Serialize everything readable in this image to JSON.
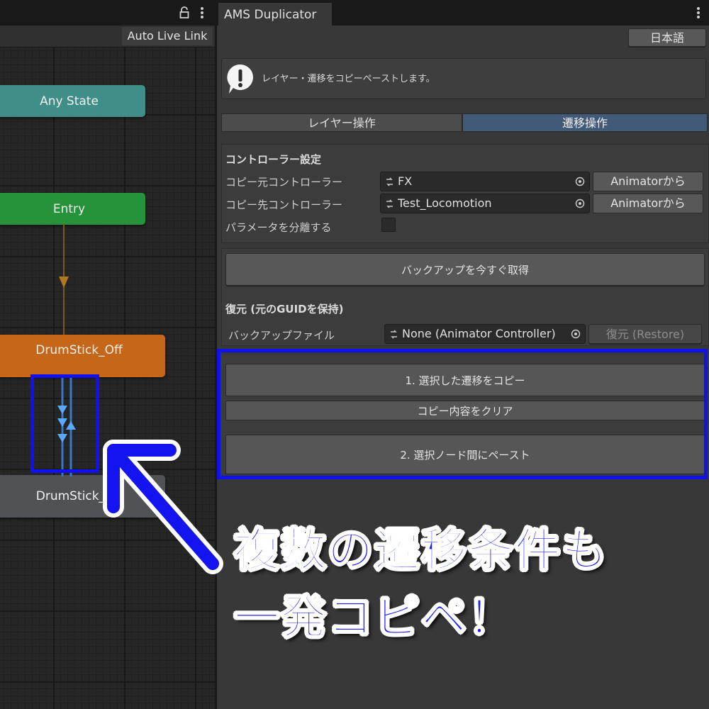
{
  "animator": {
    "auto_live_link_label": "Auto Live Link",
    "states": {
      "any_state": "Any State",
      "entry": "Entry",
      "drumstick_off": "DrumStick_Off",
      "drumstick_on": "DrumStick_On"
    },
    "colors": {
      "any_state": "#3f8e88",
      "entry": "#26933a",
      "default_state": "#c66618",
      "state": "#505255",
      "transition": "#4a90d9"
    },
    "icons": [
      "lock-icon",
      "kebab-menu-icon"
    ]
  },
  "panel": {
    "tab_title": "AMS Duplicator",
    "language_button": "日本語",
    "help_text": "レイヤー・遷移をコピーペーストします。",
    "mode_tabs": [
      {
        "label": "レイヤー操作",
        "selected": false
      },
      {
        "label": "遷移操作",
        "selected": true
      }
    ],
    "controller_settings": {
      "title": "コントローラー設定",
      "source_label": "コピー元コントローラー",
      "source_value": "FX",
      "target_label": "コピー先コントローラー",
      "target_value": "Test_Locomotion",
      "from_animator_label": "Animatorから",
      "separate_params_label": "パラメータを分離する",
      "separate_params_checked": false
    },
    "backup": {
      "backup_now_label": "バックアップを今すぐ取得",
      "restore_title": "復元 (元のGUIDを保持)",
      "backup_file_label": "バックアップファイル",
      "backup_file_value": "None (Animator Controller)",
      "restore_label": "復元 (Restore)"
    },
    "transition_ops": {
      "copy_label": "1. 選択した遷移をコピー",
      "clear_label": "コピー内容をクリア",
      "paste_label": "2. 選択ノード間にペースト"
    }
  },
  "overlay": {
    "line1": "複数の遷移条件も",
    "line2": "一発コピペ！",
    "highlight_color": "#1010f0"
  }
}
